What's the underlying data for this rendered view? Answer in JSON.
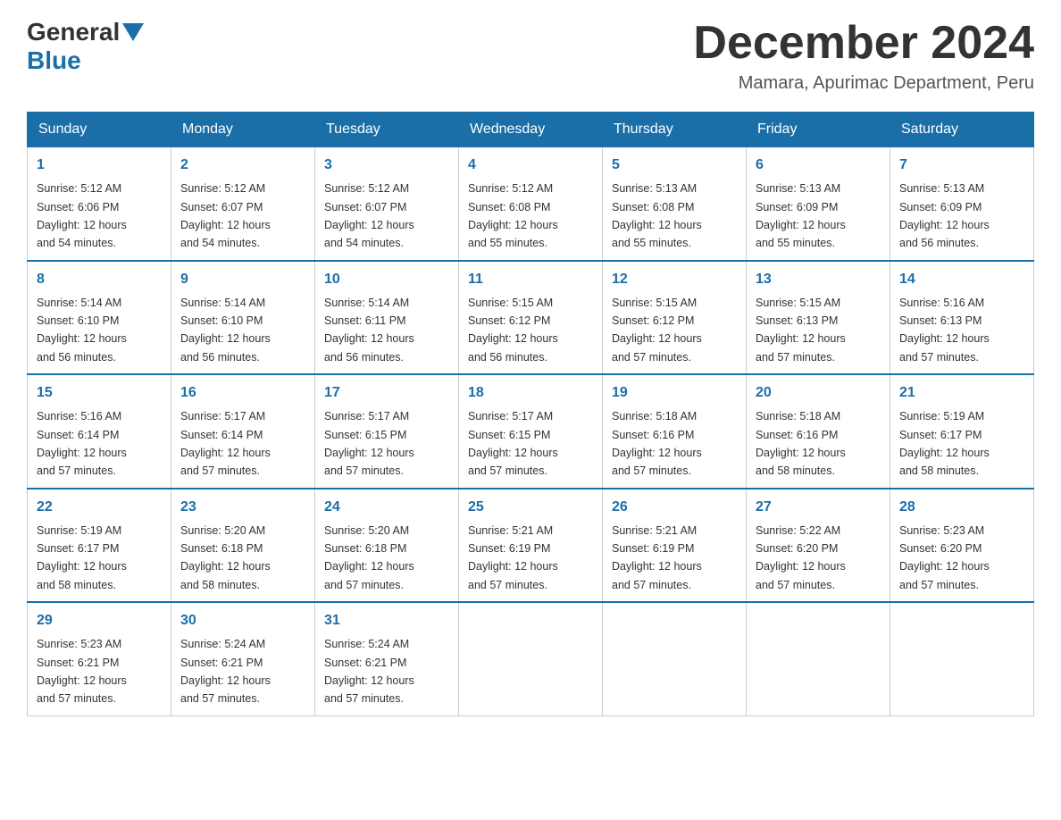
{
  "header": {
    "logo_general": "General",
    "logo_blue": "Blue",
    "month_title": "December 2024",
    "location": "Mamara, Apurimac Department, Peru"
  },
  "days_of_week": [
    "Sunday",
    "Monday",
    "Tuesday",
    "Wednesday",
    "Thursday",
    "Friday",
    "Saturday"
  ],
  "weeks": [
    [
      {
        "day": "1",
        "sunrise": "5:12 AM",
        "sunset": "6:06 PM",
        "daylight": "12 hours and 54 minutes."
      },
      {
        "day": "2",
        "sunrise": "5:12 AM",
        "sunset": "6:07 PM",
        "daylight": "12 hours and 54 minutes."
      },
      {
        "day": "3",
        "sunrise": "5:12 AM",
        "sunset": "6:07 PM",
        "daylight": "12 hours and 54 minutes."
      },
      {
        "day": "4",
        "sunrise": "5:12 AM",
        "sunset": "6:08 PM",
        "daylight": "12 hours and 55 minutes."
      },
      {
        "day": "5",
        "sunrise": "5:13 AM",
        "sunset": "6:08 PM",
        "daylight": "12 hours and 55 minutes."
      },
      {
        "day": "6",
        "sunrise": "5:13 AM",
        "sunset": "6:09 PM",
        "daylight": "12 hours and 55 minutes."
      },
      {
        "day": "7",
        "sunrise": "5:13 AM",
        "sunset": "6:09 PM",
        "daylight": "12 hours and 56 minutes."
      }
    ],
    [
      {
        "day": "8",
        "sunrise": "5:14 AM",
        "sunset": "6:10 PM",
        "daylight": "12 hours and 56 minutes."
      },
      {
        "day": "9",
        "sunrise": "5:14 AM",
        "sunset": "6:10 PM",
        "daylight": "12 hours and 56 minutes."
      },
      {
        "day": "10",
        "sunrise": "5:14 AM",
        "sunset": "6:11 PM",
        "daylight": "12 hours and 56 minutes."
      },
      {
        "day": "11",
        "sunrise": "5:15 AM",
        "sunset": "6:12 PM",
        "daylight": "12 hours and 56 minutes."
      },
      {
        "day": "12",
        "sunrise": "5:15 AM",
        "sunset": "6:12 PM",
        "daylight": "12 hours and 57 minutes."
      },
      {
        "day": "13",
        "sunrise": "5:15 AM",
        "sunset": "6:13 PM",
        "daylight": "12 hours and 57 minutes."
      },
      {
        "day": "14",
        "sunrise": "5:16 AM",
        "sunset": "6:13 PM",
        "daylight": "12 hours and 57 minutes."
      }
    ],
    [
      {
        "day": "15",
        "sunrise": "5:16 AM",
        "sunset": "6:14 PM",
        "daylight": "12 hours and 57 minutes."
      },
      {
        "day": "16",
        "sunrise": "5:17 AM",
        "sunset": "6:14 PM",
        "daylight": "12 hours and 57 minutes."
      },
      {
        "day": "17",
        "sunrise": "5:17 AM",
        "sunset": "6:15 PM",
        "daylight": "12 hours and 57 minutes."
      },
      {
        "day": "18",
        "sunrise": "5:17 AM",
        "sunset": "6:15 PM",
        "daylight": "12 hours and 57 minutes."
      },
      {
        "day": "19",
        "sunrise": "5:18 AM",
        "sunset": "6:16 PM",
        "daylight": "12 hours and 57 minutes."
      },
      {
        "day": "20",
        "sunrise": "5:18 AM",
        "sunset": "6:16 PM",
        "daylight": "12 hours and 58 minutes."
      },
      {
        "day": "21",
        "sunrise": "5:19 AM",
        "sunset": "6:17 PM",
        "daylight": "12 hours and 58 minutes."
      }
    ],
    [
      {
        "day": "22",
        "sunrise": "5:19 AM",
        "sunset": "6:17 PM",
        "daylight": "12 hours and 58 minutes."
      },
      {
        "day": "23",
        "sunrise": "5:20 AM",
        "sunset": "6:18 PM",
        "daylight": "12 hours and 58 minutes."
      },
      {
        "day": "24",
        "sunrise": "5:20 AM",
        "sunset": "6:18 PM",
        "daylight": "12 hours and 57 minutes."
      },
      {
        "day": "25",
        "sunrise": "5:21 AM",
        "sunset": "6:19 PM",
        "daylight": "12 hours and 57 minutes."
      },
      {
        "day": "26",
        "sunrise": "5:21 AM",
        "sunset": "6:19 PM",
        "daylight": "12 hours and 57 minutes."
      },
      {
        "day": "27",
        "sunrise": "5:22 AM",
        "sunset": "6:20 PM",
        "daylight": "12 hours and 57 minutes."
      },
      {
        "day": "28",
        "sunrise": "5:23 AM",
        "sunset": "6:20 PM",
        "daylight": "12 hours and 57 minutes."
      }
    ],
    [
      {
        "day": "29",
        "sunrise": "5:23 AM",
        "sunset": "6:21 PM",
        "daylight": "12 hours and 57 minutes."
      },
      {
        "day": "30",
        "sunrise": "5:24 AM",
        "sunset": "6:21 PM",
        "daylight": "12 hours and 57 minutes."
      },
      {
        "day": "31",
        "sunrise": "5:24 AM",
        "sunset": "6:21 PM",
        "daylight": "12 hours and 57 minutes."
      },
      null,
      null,
      null,
      null
    ]
  ],
  "labels": {
    "sunrise": "Sunrise:",
    "sunset": "Sunset:",
    "daylight": "Daylight:"
  }
}
